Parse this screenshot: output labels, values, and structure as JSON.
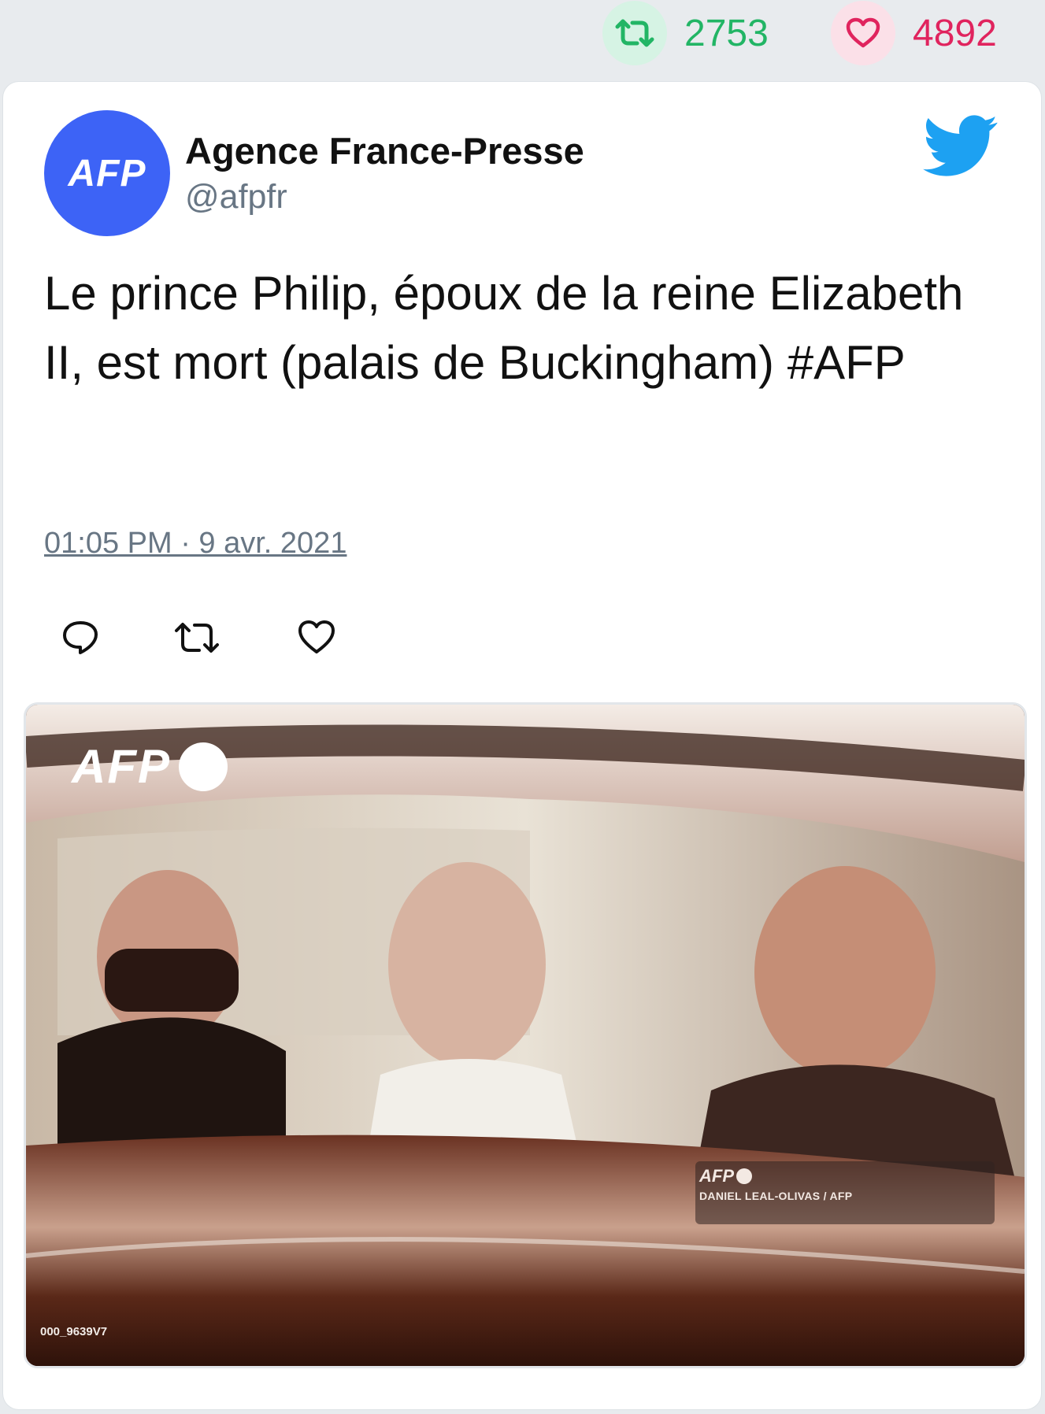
{
  "stats": {
    "retweets": "2753",
    "likes": "4892"
  },
  "tweet": {
    "author_name": "Agence France-Presse",
    "author_handle": "@afpfr",
    "avatar_text": "AFP",
    "text": "Le prince Philip, époux de la reine Elizabeth II, est mort (palais de Buckingham) #AFP",
    "timestamp": "01:05 PM · 9 avr. 2021"
  },
  "media": {
    "watermark": "AFP",
    "credit_logo": "AFP",
    "credit": "DANIEL LEAL-OLIVAS / AFP",
    "photo_code": "000_9639V7"
  },
  "colors": {
    "retweet_green": "#22b565",
    "like_pink": "#e0245e",
    "twitter_blue": "#1da1f2",
    "afp_blue": "#3d63f6",
    "meta_gray": "#687684"
  },
  "icons": {
    "retweet": "retweet-icon",
    "like": "heart-icon",
    "reply": "reply-icon",
    "brand": "twitter-bird-icon"
  }
}
